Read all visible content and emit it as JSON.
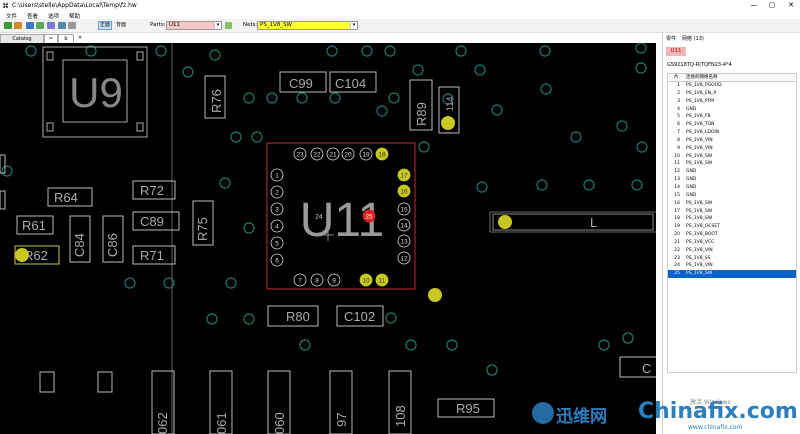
{
  "window": {
    "title": "C:\\Users\\stelle\\AppData\\Local\\Temp\\fz.hw",
    "min": "—",
    "max": "▢",
    "close": "✕"
  },
  "menu": [
    "文件",
    "查看",
    "选项",
    "帮助"
  ],
  "toolbar": {
    "mode_a": "正面",
    "mode_b": "背面",
    "parts_label": "Parts:",
    "parts_value": "U11",
    "nets_label": "Nets:",
    "nets_value": "PS_1V8_SW"
  },
  "tabs": [
    "Catalog",
    "✂",
    "b",
    "✕"
  ],
  "board": {
    "big_labels": {
      "u9": "U9",
      "u11": "U11",
      "l": "L"
    },
    "components": [
      {
        "id": "r76",
        "label": "R76"
      },
      {
        "id": "c99",
        "label": "C99"
      },
      {
        "id": "c104",
        "label": "C104"
      },
      {
        "id": "r89",
        "label": "R89"
      },
      {
        "id": "c114",
        "label": "114"
      },
      {
        "id": "r64",
        "label": "R64"
      },
      {
        "id": "r72",
        "label": "R72"
      },
      {
        "id": "c89",
        "label": "C89"
      },
      {
        "id": "r75",
        "label": "R75"
      },
      {
        "id": "r61",
        "label": "R61"
      },
      {
        "id": "c84",
        "label": "C84"
      },
      {
        "id": "c86",
        "label": "C86"
      },
      {
        "id": "r71",
        "label": "R71"
      },
      {
        "id": "r62",
        "label": "R62"
      },
      {
        "id": "r80",
        "label": "R80"
      },
      {
        "id": "c102",
        "label": "C102"
      },
      {
        "id": "r95",
        "label": "R95"
      },
      {
        "id": "c_edge",
        "label": "C"
      },
      {
        "id": "b062",
        "label": "062"
      },
      {
        "id": "b061",
        "label": "061"
      },
      {
        "id": "b060",
        "label": "060"
      },
      {
        "id": "b97",
        "label": "97"
      },
      {
        "id": "b108",
        "label": "108"
      }
    ],
    "pins": [
      "1",
      "2",
      "3",
      "4",
      "5",
      "6",
      "7",
      "8",
      "9",
      "10",
      "11",
      "12",
      "13",
      "14",
      "15",
      "16",
      "17",
      "18",
      "19",
      "20",
      "21",
      "22",
      "23",
      "24",
      "25"
    ]
  },
  "right": {
    "tab_a": "零件",
    "tab_b": "网络 (13)",
    "part": "U11",
    "package": "GS9218TQ-R(TQFN23-4*4",
    "col_pin": "片.",
    "col_net": "连接的网络名称",
    "rows": [
      {
        "n": "1",
        "net": "PS_1V8_PGOOD"
      },
      {
        "n": "2",
        "net": "PS_1V8_EN_R"
      },
      {
        "n": "3",
        "net": "PS_1V8_PFM"
      },
      {
        "n": "4",
        "net": "GND"
      },
      {
        "n": "5",
        "net": "PS_1V8_FB"
      },
      {
        "n": "6",
        "net": "PS_1V8_TON"
      },
      {
        "n": "7",
        "net": "PS_1V8_LDOIN"
      },
      {
        "n": "8",
        "net": "PS_1V8_VIN"
      },
      {
        "n": "9",
        "net": "PS_1V8_VIN"
      },
      {
        "n": "10",
        "net": "PS_1V8_SW"
      },
      {
        "n": "11",
        "net": "PS_1V8_SW"
      },
      {
        "n": "12",
        "net": "GND"
      },
      {
        "n": "13",
        "net": "GND"
      },
      {
        "n": "14",
        "net": "GND"
      },
      {
        "n": "15",
        "net": "GND"
      },
      {
        "n": "16",
        "net": "PS_1V8_SW"
      },
      {
        "n": "17",
        "net": "PS_1V8_SW"
      },
      {
        "n": "18",
        "net": "PS_1V8_SW"
      },
      {
        "n": "19",
        "net": "PS_1V8_OCSET"
      },
      {
        "n": "20",
        "net": "PS_1V8_BOOT"
      },
      {
        "n": "21",
        "net": "PS_1V8_VCC"
      },
      {
        "n": "22",
        "net": "PS_1V8_VIN"
      },
      {
        "n": "23",
        "net": "PS_1V8_SS"
      },
      {
        "n": "24",
        "net": "PS_1V8_VIN"
      },
      {
        "n": "25",
        "net": "PS_1V8_SW"
      }
    ]
  },
  "watermark": {
    "cn": "迅维网",
    "en": "Chinafix.com",
    "sub": "激活 Windows",
    "url": "www.chinafix.com"
  }
}
